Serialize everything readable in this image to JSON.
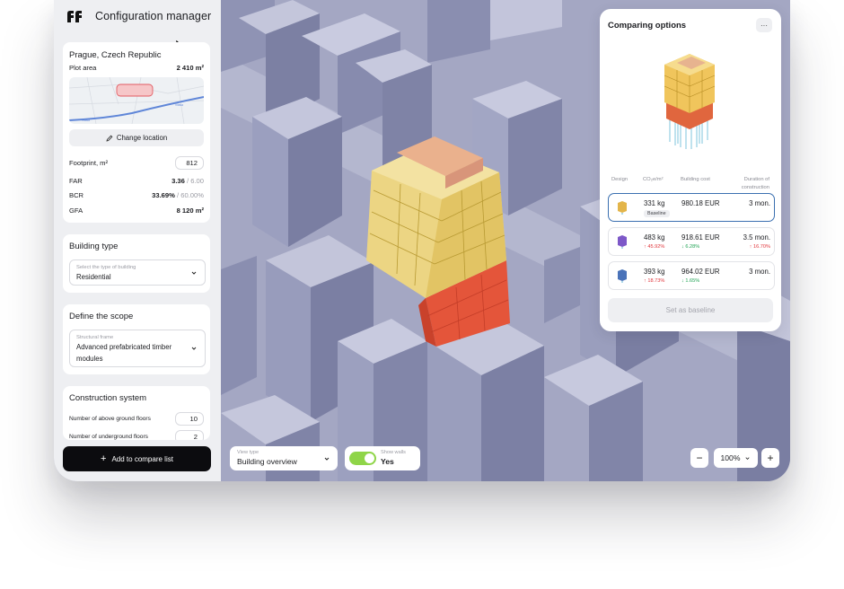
{
  "app": {
    "title": "Configuration manager",
    "logo": "ff"
  },
  "location": {
    "city": "Prague, Czech Republic",
    "plot_area_label": "Plot area",
    "plot_area_value": "2 410 m²",
    "map_labels": [
      "Vltava",
      "Vltava"
    ],
    "change_location": "Change location",
    "footprint_label": "Footprint, m²",
    "footprint_value": "812",
    "far_label": "FAR",
    "far_value": "3.36",
    "far_max": "/ 6.00",
    "bcr_label": "BCR",
    "bcr_value": "33.69%",
    "bcr_max": "/ 60.00%",
    "gfa_label": "GFA",
    "gfa_value": "8 120 m²"
  },
  "building_type": {
    "title": "Building type",
    "select_label": "Select the type of building",
    "select_value": "Residential"
  },
  "scope": {
    "title": "Define the scope",
    "select_label": "Structural frame",
    "select_value_line1": "Advanced prefabricated timber",
    "select_value_line2": "modules"
  },
  "construction": {
    "title": "Construction system",
    "floors_label": "Number of above ground floors",
    "floors_value": "10",
    "second_label": "Number of underground floors",
    "second_value": "2"
  },
  "add_button": "Add to compare list",
  "comparing": {
    "title": "Comparing options",
    "menu": "···",
    "headers": {
      "design": "Design",
      "co2": "CO₂e/m²",
      "cost": "Building cost",
      "duration_1": "Duration of",
      "duration_2": "construction"
    },
    "options": [
      {
        "co2": "331 kg",
        "cost": "980.18 EUR",
        "duration": "3 mon.",
        "badge": "Baseline",
        "color": "#e3b54a"
      },
      {
        "co2": "483 kg",
        "cost": "918.61 EUR",
        "duration": "3.5 mon.",
        "delta_co2": "↑ 45.92%",
        "delta_cost": "↓ 6.28%",
        "delta_duration": "↑ 16.70%",
        "color": "#7d58c8"
      },
      {
        "co2": "393 kg",
        "cost": "964.02 EUR",
        "duration": "3 mon.",
        "delta_co2": "↑ 18.73%",
        "delta_cost": "↓ 1.65%",
        "color": "#4a73b9"
      }
    ],
    "set_baseline": "Set as baseline"
  },
  "view_type": {
    "label": "View type",
    "value": "Building overview"
  },
  "show_walls": {
    "label": "Show walls",
    "value": "Yes"
  },
  "zoom": {
    "minus": "−",
    "value": "100%",
    "plus": "+"
  }
}
